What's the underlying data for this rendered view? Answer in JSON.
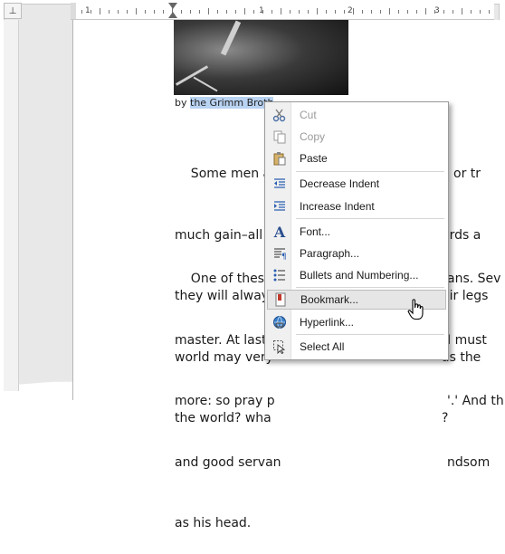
{
  "ruler": {
    "corner_symbol": "⊥",
    "numbers": [
      "1",
      "1",
      "2",
      "3"
    ]
  },
  "document": {
    "byline_prefix": "by ",
    "byline_selected": "the Grimm Broth",
    "paragraph1": [
      "    Some men a",
      "much gain–all t",
      "they will always",
      "world may very",
      "the world? wha"
    ],
    "paragraph1_right": [
      "o or tr",
      "ards a",
      "eir legs",
      "as the",
      "?"
    ],
    "paragraph2": [
      "    One of these",
      "master. At last I",
      "more: so pray p",
      "and good servan",
      "as his head."
    ],
    "paragraph2_right": [
      "ans. Sev",
      "I must",
      "'.' And th",
      "ndsom",
      ""
    ]
  },
  "context_menu": {
    "items": [
      {
        "label": "Cut",
        "icon": "scissors-icon",
        "disabled": true
      },
      {
        "label": "Copy",
        "icon": "copy-icon",
        "disabled": true
      },
      {
        "label": "Paste",
        "icon": "paste-icon",
        "disabled": false
      },
      {
        "label": "Decrease Indent",
        "icon": "decrease-indent-icon",
        "disabled": false
      },
      {
        "label": "Increase Indent",
        "icon": "increase-indent-icon",
        "disabled": false
      },
      {
        "label": "Font...",
        "icon": "font-icon",
        "disabled": false
      },
      {
        "label": "Paragraph...",
        "icon": "paragraph-icon",
        "disabled": false
      },
      {
        "label": "Bullets and Numbering...",
        "icon": "bullets-icon",
        "disabled": false
      },
      {
        "label": "Bookmark...",
        "icon": "bookmark-icon",
        "disabled": false,
        "highlighted": true
      },
      {
        "label": "Hyperlink...",
        "icon": "hyperlink-icon",
        "disabled": false
      },
      {
        "label": "Select All",
        "icon": "select-all-icon",
        "disabled": false
      }
    ]
  },
  "colors": {
    "selection": "#b9d3f2",
    "menu_highlight": "#e6e6e6",
    "icon_blue": "#2b5fb0"
  }
}
